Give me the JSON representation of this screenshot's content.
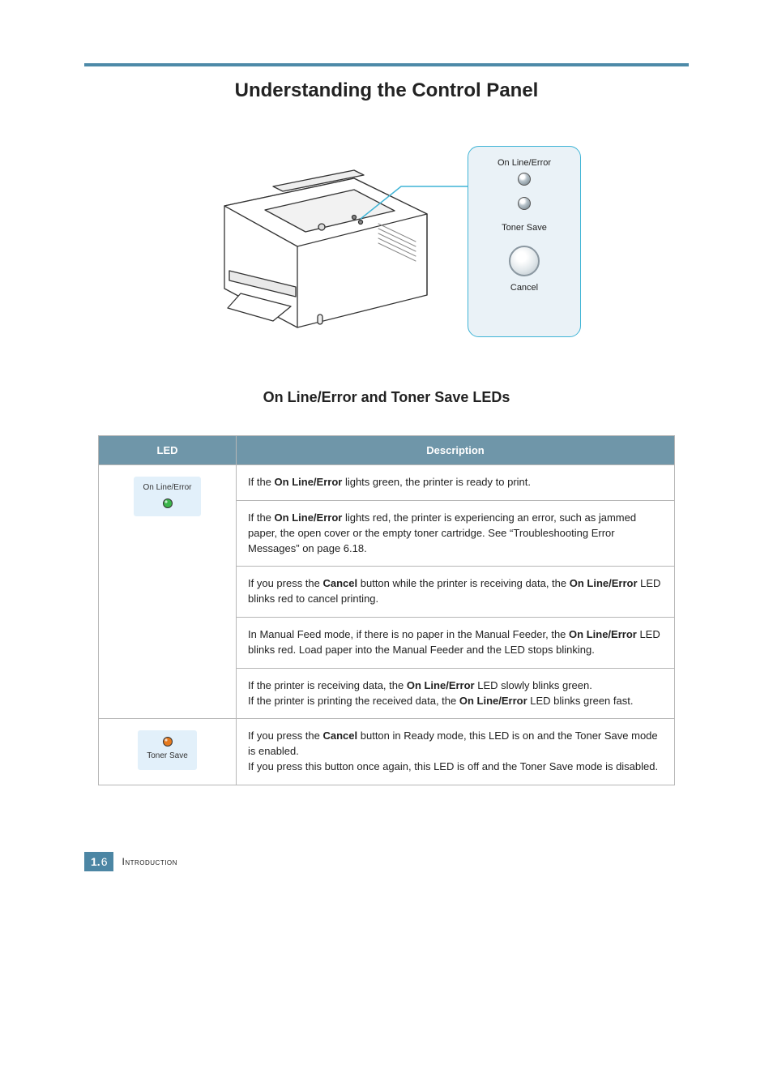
{
  "heading": "Understanding the Control Panel",
  "subheading": "On Line/Error and Toner Save LEDs",
  "callout": {
    "label_online": "On Line/Error",
    "label_toner": "Toner Save",
    "label_cancel": "Cancel"
  },
  "table": {
    "headers": {
      "led": "LED",
      "desc": "Description"
    },
    "rows": [
      {
        "led_label": "On Line/Error",
        "led_color": "#3bb54a",
        "led_chip": true,
        "desc_segments": [
          {
            "t": "If the "
          },
          {
            "t": "On Line/Error",
            "b": true
          },
          {
            "t": " lights green, the printer is ready to print."
          }
        ]
      },
      {
        "led_chip": false,
        "desc_segments": [
          {
            "t": "If the "
          },
          {
            "t": "On Line/Error",
            "b": true
          },
          {
            "t": " lights red, the printer is experiencing an error, such as jammed paper, the open cover or the empty toner cartridge. See “Troubleshooting Error Messages” on page 6.18."
          }
        ]
      },
      {
        "led_chip": false,
        "desc_segments": [
          {
            "t": "If you press the "
          },
          {
            "t": "Cancel",
            "b": true
          },
          {
            "t": " button while the printer is receiving data, the "
          },
          {
            "t": "On Line/Error",
            "b": true
          },
          {
            "t": " LED blinks red to cancel printing."
          }
        ]
      },
      {
        "led_chip": false,
        "desc_segments": [
          {
            "t": "In Manual Feed mode, if there is no paper in the Manual Feeder, the "
          },
          {
            "t": "On Line/Error",
            "b": true
          },
          {
            "t": " LED blinks red. Load paper into the Manual Feeder and the LED stops blinking."
          }
        ]
      },
      {
        "led_chip": false,
        "desc_segments": [
          {
            "t": "If the printer is receiving data, the "
          },
          {
            "t": "On Line/Error",
            "b": true
          },
          {
            "t": " LED slowly blinks green."
          },
          {
            "br": true
          },
          {
            "t": "If the printer is printing the received data, the "
          },
          {
            "t": "On Line/Error",
            "b": true
          },
          {
            "t": " LED blinks green fast."
          }
        ]
      },
      {
        "led_label": "Toner Save",
        "led_color": "#e67a1e",
        "led_chip": true,
        "below_label": true,
        "desc_segments": [
          {
            "t": "If you press the "
          },
          {
            "t": "Cancel",
            "b": true
          },
          {
            "t": " button in Ready mode, this LED is on and the Toner Save mode is enabled."
          },
          {
            "br": true
          },
          {
            "t": "If you press this button once again, this LED is off and the Toner Save mode is disabled."
          }
        ]
      }
    ]
  },
  "footer": {
    "chapter": "1.",
    "page": "6",
    "section": "Introduction"
  }
}
